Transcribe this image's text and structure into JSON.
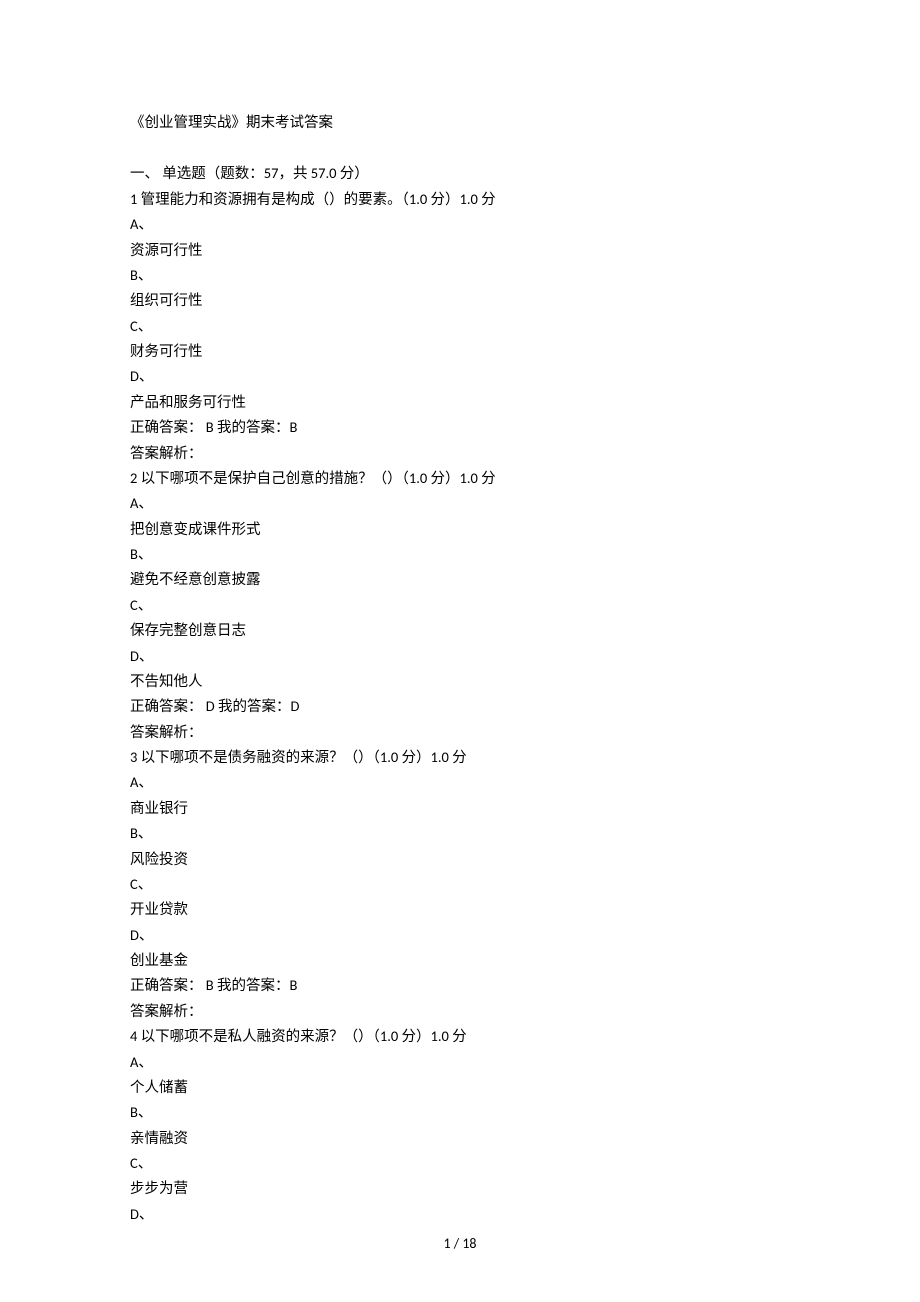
{
  "title": "《创业管理实战》期末考试答案",
  "section": "一、 单选题（题数：57，共 57.0 分）",
  "q1": {
    "stem": "1 管理能力和资源拥有是构成（）的要素。（1.0 分）1.0 分",
    "optA_label": "A、",
    "optA_text": "资源可行性",
    "optB_label": "B、",
    "optB_text": "组织可行性",
    "optC_label": "C、",
    "optC_text": "财务可行性",
    "optD_label": "D、",
    "optD_text": "产品和服务可行性",
    "answer": "正确答案： B 我的答案：B",
    "analysis": "答案解析："
  },
  "q2": {
    "stem": "2 以下哪项不是保护自己创意的措施？（）（1.0 分）1.0 分",
    "optA_label": "A、",
    "optA_text": "把创意变成课件形式",
    "optB_label": "B、",
    "optB_text": "避免不经意创意披露",
    "optC_label": "C、",
    "optC_text": "保存完整创意日志",
    "optD_label": "D、",
    "optD_text": "不告知他人",
    "answer": "正确答案： D 我的答案：D",
    "analysis": "答案解析："
  },
  "q3": {
    "stem": "3 以下哪项不是债务融资的来源？（）（1.0 分）1.0 分",
    "optA_label": "A、",
    "optA_text": "商业银行",
    "optB_label": "B、",
    "optB_text": "风险投资",
    "optC_label": "C、",
    "optC_text": "开业贷款",
    "optD_label": "D、",
    "optD_text": "创业基金",
    "answer": "正确答案： B 我的答案：B",
    "analysis": "答案解析："
  },
  "q4": {
    "stem": "4 以下哪项不是私人融资的来源？（）（1.0 分）1.0 分",
    "optA_label": "A、",
    "optA_text": "个人储蓄",
    "optB_label": "B、",
    "optB_text": "亲情融资",
    "optC_label": "C、",
    "optC_text": "步步为营",
    "optD_label": "D、"
  },
  "footer": "1 / 18"
}
